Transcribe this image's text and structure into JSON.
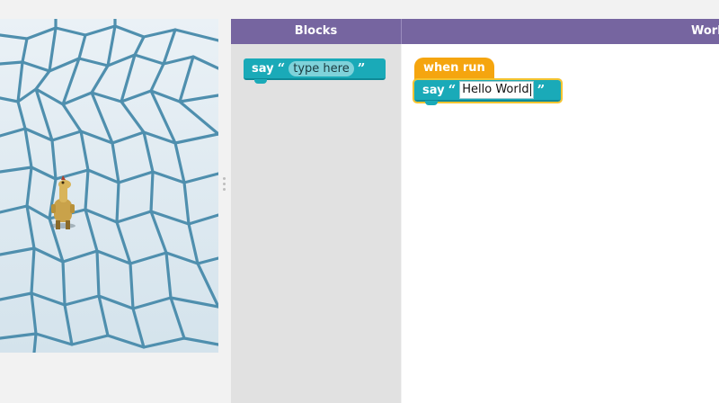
{
  "header": {
    "blocks_label": "Blocks",
    "workspace_label": "Work"
  },
  "toolbox": {
    "say_block": {
      "keyword": "say",
      "open_quote": "“",
      "close_quote": "”",
      "field_text": "type here"
    }
  },
  "workspace": {
    "event_block": {
      "label": "when run"
    },
    "say_block": {
      "keyword": "say",
      "open_quote": "“",
      "close_quote": "”",
      "field_text": "Hello World"
    }
  },
  "colors": {
    "header": "#7665a0",
    "say_block": "#1aaab8",
    "event_block": "#f5a50f",
    "toolbox_bg": "#e1e1e1",
    "ice": "#dfeaf1",
    "crack": "#4f8fae"
  }
}
